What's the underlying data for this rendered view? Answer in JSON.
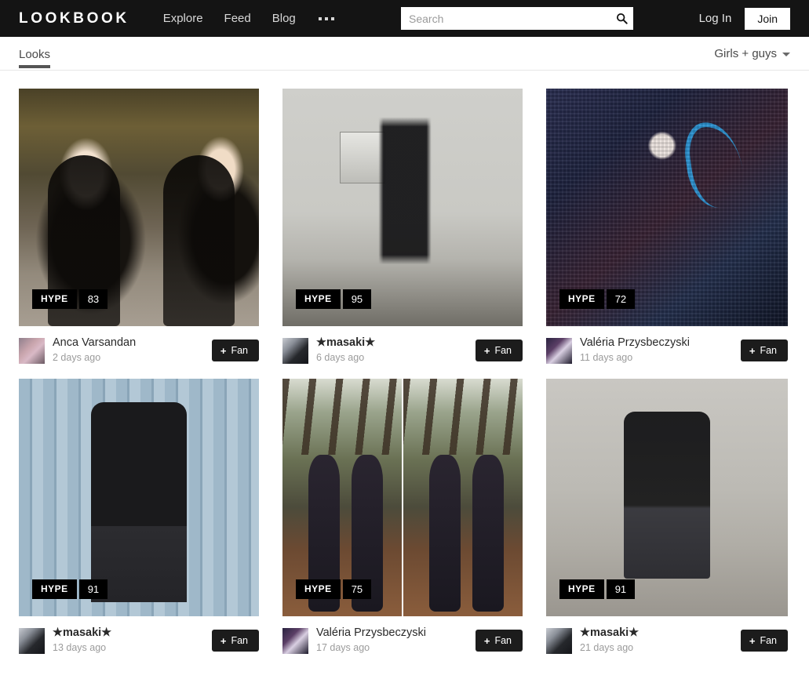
{
  "header": {
    "brand": "LOOKBOOK",
    "nav": [
      {
        "label": "Explore",
        "name": "nav-explore"
      },
      {
        "label": "Feed",
        "name": "nav-feed"
      },
      {
        "label": "Blog",
        "name": "nav-blog"
      }
    ],
    "more_label": "•••",
    "search": {
      "placeholder": "Search",
      "value": ""
    },
    "login_label": "Log In",
    "join_label": "Join",
    "bg_color": "#141414"
  },
  "subnav": {
    "tab_label": "Looks",
    "filter_label": "Girls + guys"
  },
  "labels": {
    "hype": "HYPE",
    "fan": "Fan",
    "plus": "+"
  },
  "cards": [
    {
      "hype": "83",
      "username": "Anca Varsandan",
      "username_bold": false,
      "time": "2 days ago",
      "fan_label": "Fan",
      "photo_class": "p1",
      "avatar_class": "av1",
      "split": false
    },
    {
      "hype": "95",
      "username": "★masaki★",
      "username_bold": true,
      "time": "6 days ago",
      "fan_label": "Fan",
      "photo_class": "p2",
      "avatar_class": "av2",
      "split": false
    },
    {
      "hype": "72",
      "username": "Valéria Przysbeczyski",
      "username_bold": false,
      "time": "11 days ago",
      "fan_label": "Fan",
      "photo_class": "p3",
      "avatar_class": "av3",
      "split": false
    },
    {
      "hype": "91",
      "username": "★masaki★",
      "username_bold": true,
      "time": "13 days ago",
      "fan_label": "Fan",
      "photo_class": "p4",
      "avatar_class": "av2",
      "split": false
    },
    {
      "hype": "75",
      "username": "Valéria Przysbeczyski",
      "username_bold": false,
      "time": "17 days ago",
      "fan_label": "Fan",
      "photo_class": "p5",
      "avatar_class": "av3",
      "split": true
    },
    {
      "hype": "91",
      "username": "★masaki★",
      "username_bold": true,
      "time": "21 days ago",
      "fan_label": "Fan",
      "photo_class": "p6",
      "avatar_class": "av2",
      "split": false
    }
  ]
}
